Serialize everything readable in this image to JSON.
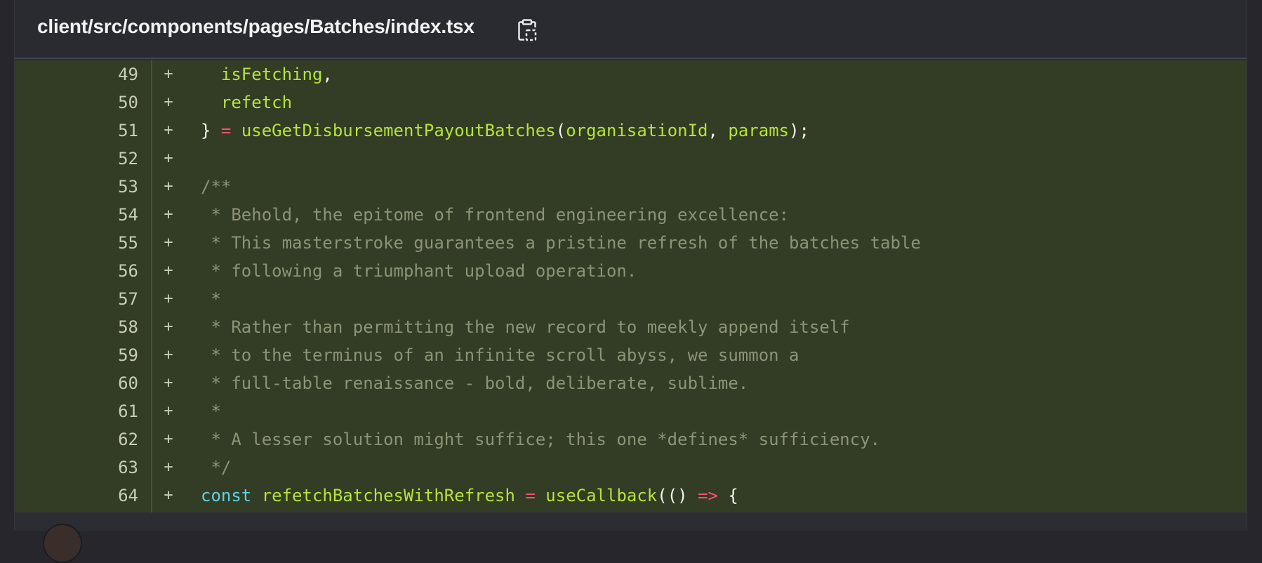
{
  "header": {
    "file_path": "client/src/components/pages/Batches/index.tsx",
    "copy_icon": "clipboard-copy-icon"
  },
  "diff": {
    "marker": "+",
    "lines": [
      {
        "num": "49",
        "tokens": [
          {
            "t": "  ",
            "c": "punc"
          },
          {
            "t": "isFetching",
            "c": "var"
          },
          {
            "t": ",",
            "c": "punc"
          }
        ]
      },
      {
        "num": "50",
        "tokens": [
          {
            "t": "  ",
            "c": "punc"
          },
          {
            "t": "refetch",
            "c": "var"
          }
        ]
      },
      {
        "num": "51",
        "tokens": [
          {
            "t": "} ",
            "c": "punc"
          },
          {
            "t": "=",
            "c": "op"
          },
          {
            "t": " ",
            "c": "punc"
          },
          {
            "t": "useGetDisbursementPayoutBatches",
            "c": "fn"
          },
          {
            "t": "(",
            "c": "punc"
          },
          {
            "t": "organisationId",
            "c": "var"
          },
          {
            "t": ", ",
            "c": "punc"
          },
          {
            "t": "params",
            "c": "var"
          },
          {
            "t": ");",
            "c": "punc"
          }
        ]
      },
      {
        "num": "52",
        "tokens": []
      },
      {
        "num": "53",
        "tokens": [
          {
            "t": "/**",
            "c": "cm"
          }
        ]
      },
      {
        "num": "54",
        "tokens": [
          {
            "t": " * Behold, the epitome of frontend engineering excellence:",
            "c": "cm"
          }
        ]
      },
      {
        "num": "55",
        "tokens": [
          {
            "t": " * This masterstroke guarantees a pristine refresh of the batches table",
            "c": "cm"
          }
        ]
      },
      {
        "num": "56",
        "tokens": [
          {
            "t": " * following a triumphant upload operation.",
            "c": "cm"
          }
        ]
      },
      {
        "num": "57",
        "tokens": [
          {
            "t": " *",
            "c": "cm"
          }
        ]
      },
      {
        "num": "58",
        "tokens": [
          {
            "t": " * Rather than permitting the new record to meekly append itself",
            "c": "cm"
          }
        ]
      },
      {
        "num": "59",
        "tokens": [
          {
            "t": " * to the terminus of an infinite scroll abyss, we summon a",
            "c": "cm"
          }
        ]
      },
      {
        "num": "60",
        "tokens": [
          {
            "t": " * full-table renaissance - bold, deliberate, sublime.",
            "c": "cm"
          }
        ]
      },
      {
        "num": "61",
        "tokens": [
          {
            "t": " *",
            "c": "cm"
          }
        ]
      },
      {
        "num": "62",
        "tokens": [
          {
            "t": " * A lesser solution might suffice; this one *defines* sufficiency.",
            "c": "cm"
          }
        ]
      },
      {
        "num": "63",
        "tokens": [
          {
            "t": " */",
            "c": "cm"
          }
        ]
      },
      {
        "num": "64",
        "tokens": [
          {
            "t": "const",
            "c": "kw"
          },
          {
            "t": " ",
            "c": "punc"
          },
          {
            "t": "refetchBatchesWithRefresh",
            "c": "var"
          },
          {
            "t": " ",
            "c": "punc"
          },
          {
            "t": "=",
            "c": "op"
          },
          {
            "t": " ",
            "c": "punc"
          },
          {
            "t": "useCallback",
            "c": "fn"
          },
          {
            "t": "(() ",
            "c": "punc"
          },
          {
            "t": "=>",
            "c": "op"
          },
          {
            "t": " {",
            "c": "punc"
          }
        ]
      }
    ]
  },
  "colors": {
    "background": "#26262c",
    "diff_added_bg": "#333c24",
    "identifier": "#b5e43c",
    "operator": "#ff4f7b",
    "keyword": "#5fd2e6",
    "comment": "#8c9478"
  }
}
